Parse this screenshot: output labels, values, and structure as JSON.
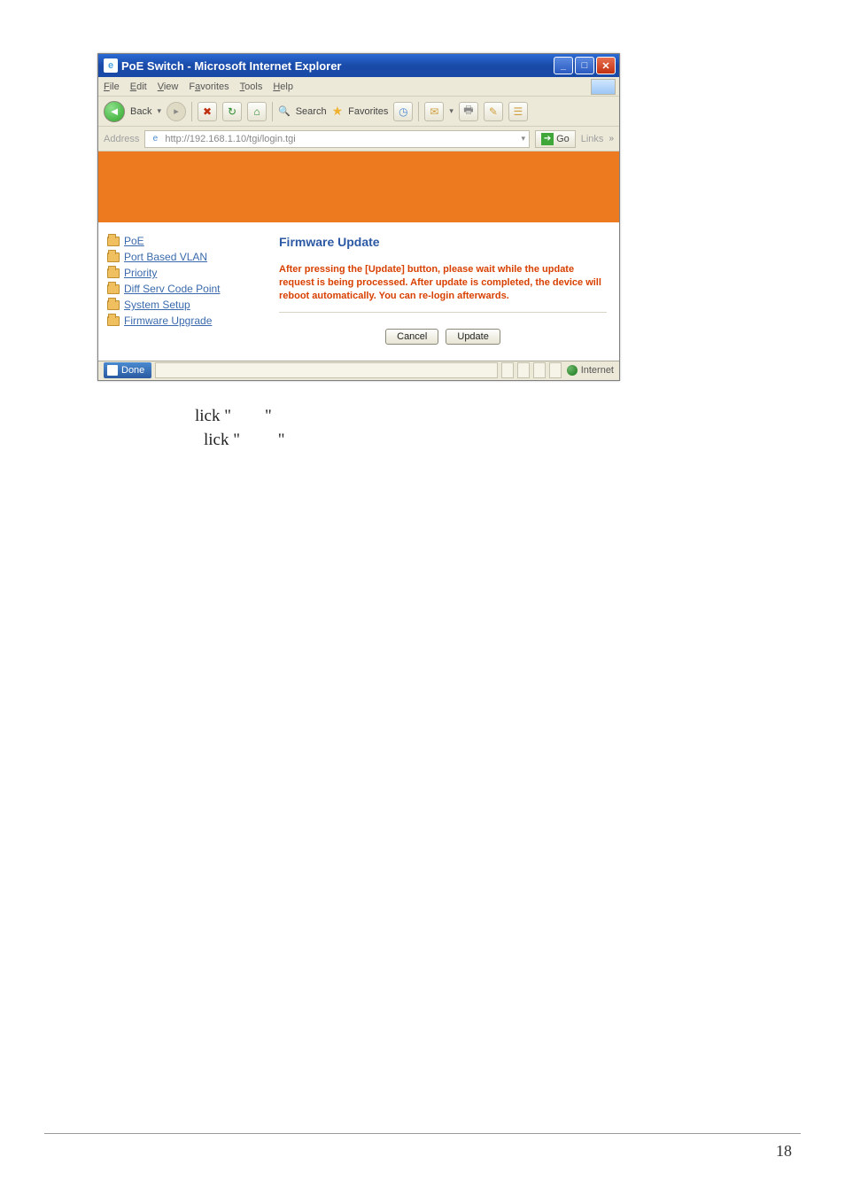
{
  "browser": {
    "title": "PoE Switch - Microsoft Internet Explorer",
    "menu": {
      "file": "File",
      "edit": "Edit",
      "view": "View",
      "favorites": "Favorites",
      "tools": "Tools",
      "help": "Help"
    },
    "toolbar": {
      "back": "Back",
      "search": "Search",
      "favorites": "Favorites"
    },
    "address_label": "Address",
    "address_value": "http://192.168.1.10/tgi/login.tgi",
    "go_label": "Go",
    "links_label": "Links",
    "status_left": "Done",
    "status_right": "Internet"
  },
  "sidebar": {
    "items": [
      {
        "label": "PoE"
      },
      {
        "label": "Port Based VLAN"
      },
      {
        "label": "Priority"
      },
      {
        "label": "Diff Serv Code Point"
      },
      {
        "label": "System Setup"
      },
      {
        "label": "Firmware Upgrade"
      }
    ]
  },
  "firmware": {
    "heading": "Firmware Update",
    "message": "After pressing the [Update] button, please wait while the update request is being processed. After update is completed, the device will reboot automatically. You can re-login afterwards.",
    "cancel": "Cancel",
    "update": "Update"
  },
  "bodytext": {
    "line1_prefix": "lick \"",
    "line1_suffix": "\"",
    "line2_prefix": "lick \"",
    "line2_suffix": "\""
  },
  "pagenum": "18"
}
